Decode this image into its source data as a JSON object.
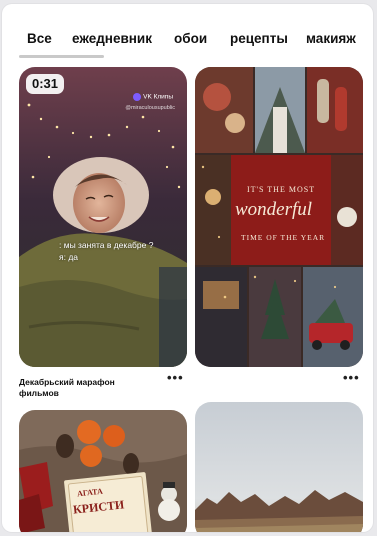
{
  "tabs": [
    {
      "label": "Все",
      "active": true
    },
    {
      "label": "ежедневник"
    },
    {
      "label": "обои"
    },
    {
      "label": "рецепты"
    },
    {
      "label": "макияж"
    }
  ],
  "pins": {
    "video": {
      "duration": "0:31",
      "source_label": "VK Клипы",
      "handle": "@miraculousupublic",
      "caption_line1": ": мы занята в декабре ?",
      "caption_line2": "я: да",
      "title": "Декабрьский марафон фильмов",
      "more_label": "•••"
    },
    "collage": {
      "line_top": "IT'S THE MOST",
      "line_script": "wonderful",
      "line_bottom": "TIME OF THE YEAR",
      "more_label": "•••"
    },
    "book": {
      "book_text_1": "АГАТА",
      "book_text_2": "КРИСТИ"
    }
  },
  "colors": {
    "tab_text": "#111111",
    "underline": "#c9c9c9",
    "card_red": "#8d1c19"
  }
}
